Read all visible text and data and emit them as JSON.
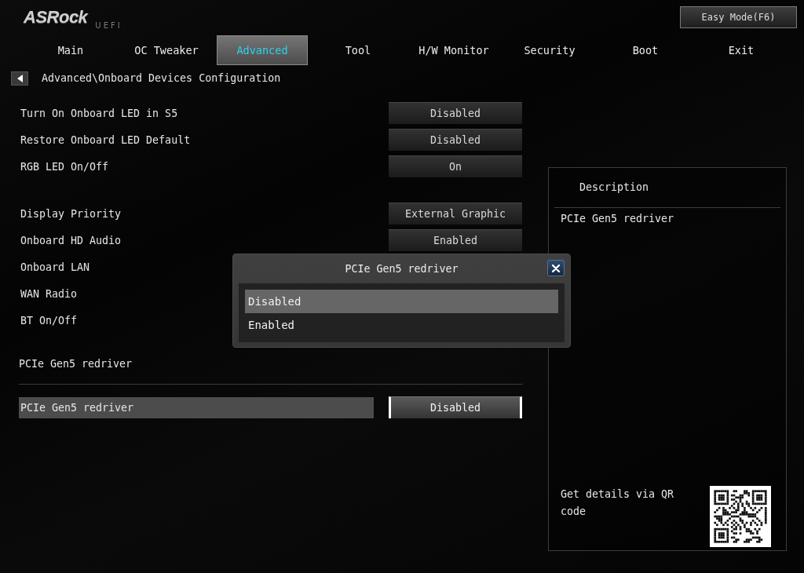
{
  "header": {
    "logo": "ASRock",
    "logo_suffix": "UEFI",
    "mode_button": "Easy Mode(F6)"
  },
  "tabs": [
    {
      "label": "Main",
      "selected": false
    },
    {
      "label": "OC Tweaker",
      "selected": false
    },
    {
      "label": "Advanced",
      "selected": true
    },
    {
      "label": "Tool",
      "selected": false
    },
    {
      "label": "H/W Monitor",
      "selected": false
    },
    {
      "label": "Security",
      "selected": false
    },
    {
      "label": "Boot",
      "selected": false
    },
    {
      "label": "Exit",
      "selected": false
    }
  ],
  "breadcrumb": "Advanced\\Onboard Devices Configuration",
  "groups": [
    {
      "items": [
        {
          "label": "Turn On Onboard LED in S5",
          "value": "Disabled",
          "selected": false
        },
        {
          "label": "Restore Onboard LED Default",
          "value": "Disabled",
          "selected": false
        },
        {
          "label": "RGB LED On/Off",
          "value": "On",
          "selected": false
        }
      ]
    },
    {
      "items": [
        {
          "label": "Display Priority",
          "value": "External Graphic",
          "selected": false
        },
        {
          "label": "Onboard HD Audio",
          "value": "Enabled",
          "selected": false
        },
        {
          "label": "Onboard LAN",
          "selected": false
        },
        {
          "label": "WAN Radio",
          "selected": false
        },
        {
          "label": "BT On/Off",
          "selected": false
        }
      ]
    },
    {
      "title": "PCIe Gen5 redriver",
      "items": [
        {
          "label": "PCIe Gen5 redriver",
          "value": "Disabled",
          "selected": true
        }
      ]
    }
  ],
  "description": {
    "title": "Description",
    "text": "PCIe Gen5 redriver",
    "qr_caption": "Get details via QR code"
  },
  "popup": {
    "title": "PCIe Gen5 redriver",
    "options": [
      {
        "label": "Disabled",
        "selected": true
      },
      {
        "label": "Enabled",
        "selected": false
      }
    ]
  }
}
